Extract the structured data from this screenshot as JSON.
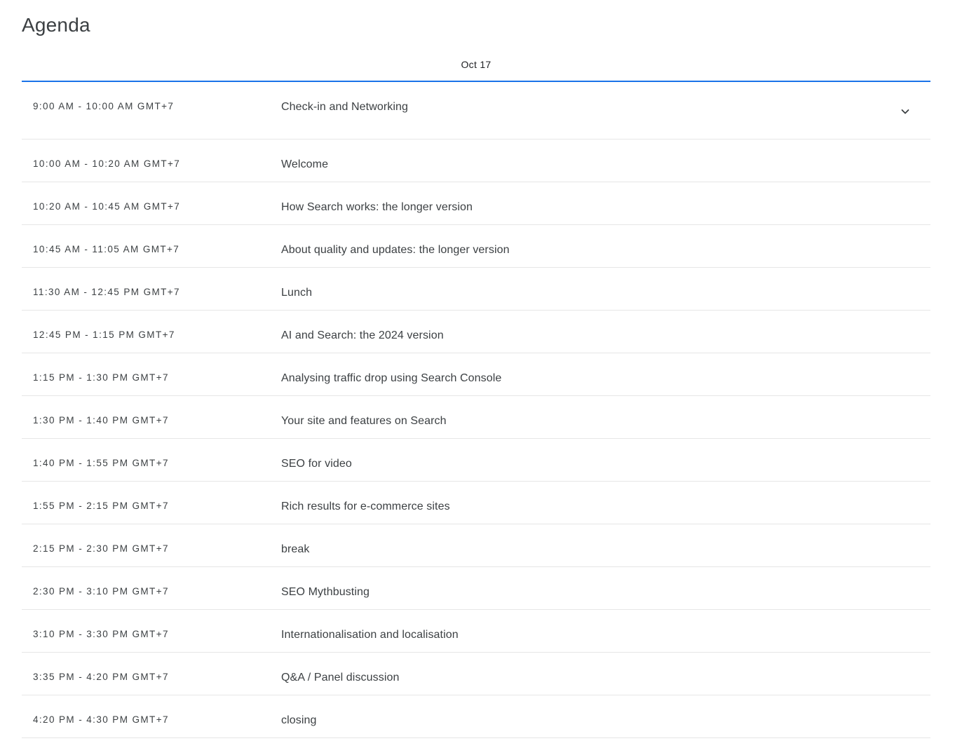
{
  "page": {
    "title": "Agenda"
  },
  "day_tabs": [
    {
      "label": "Oct 17",
      "active": true
    }
  ],
  "colors": {
    "accent": "#1a73e8",
    "text": "#3c4043",
    "divider": "#e6e6e6"
  },
  "expand_icon": "chevron-down-icon",
  "sessions": [
    {
      "time": "9:00 AM - 10:00 AM GMT+7",
      "title": "Check-in and Networking"
    },
    {
      "time": "10:00 AM - 10:20 AM GMT+7",
      "title": "Welcome"
    },
    {
      "time": "10:20 AM - 10:45 AM GMT+7",
      "title": "How Search works: the longer version"
    },
    {
      "time": "10:45 AM - 11:05 AM GMT+7",
      "title": "About quality and updates: the longer version"
    },
    {
      "time": "11:30 AM - 12:45 PM GMT+7",
      "title": "Lunch"
    },
    {
      "time": "12:45 PM - 1:15 PM GMT+7",
      "title": "AI and Search: the 2024 version"
    },
    {
      "time": "1:15 PM - 1:30 PM GMT+7",
      "title": "Analysing traffic drop using Search Console"
    },
    {
      "time": "1:30 PM - 1:40 PM GMT+7",
      "title": "Your site and features on Search"
    },
    {
      "time": "1:40 PM - 1:55 PM GMT+7",
      "title": "SEO for video"
    },
    {
      "time": "1:55 PM - 2:15 PM GMT+7",
      "title": "Rich results for e-commerce sites"
    },
    {
      "time": "2:15 PM - 2:30 PM GMT+7",
      "title": "break"
    },
    {
      "time": "2:30 PM - 3:10 PM GMT+7",
      "title": "SEO Mythbusting"
    },
    {
      "time": "3:10 PM - 3:30 PM GMT+7",
      "title": "Internationalisation and localisation"
    },
    {
      "time": "3:35 PM - 4:20 PM GMT+7",
      "title": "Q&A / Panel discussion"
    },
    {
      "time": "4:20 PM - 4:30 PM GMT+7",
      "title": "closing"
    }
  ]
}
